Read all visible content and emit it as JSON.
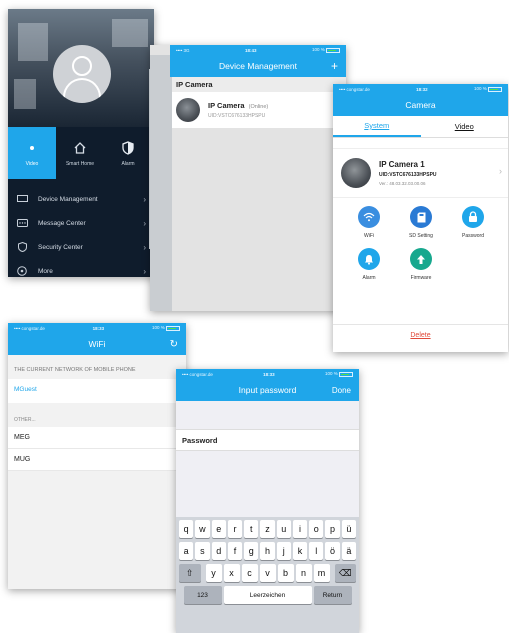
{
  "colors": {
    "accent": "#1fa6ea",
    "menu_bg": "#0f1c2c",
    "danger": "#e04a3a"
  },
  "menu_screen": {
    "tabs": [
      {
        "label": "Video",
        "icon": "dot-icon",
        "active": true
      },
      {
        "label": "Smart Home",
        "icon": "home-icon",
        "active": false
      },
      {
        "label": "Alarm",
        "icon": "shield-icon",
        "active": false
      }
    ],
    "items": [
      {
        "label": "Device Management",
        "icon": "monitor-icon"
      },
      {
        "label": "Message Center",
        "icon": "message-icon"
      },
      {
        "label": "Security Center",
        "icon": "security-shield-icon"
      },
      {
        "label": "More",
        "icon": "more-icon"
      }
    ]
  },
  "device_screen": {
    "status": {
      "left": "•••• 3G",
      "time": "18:43",
      "right": "100 %"
    },
    "title": "Device Management",
    "add": "+",
    "section": "IP Camera",
    "device": {
      "name": "IP Camera",
      "state": "(Online)",
      "uid": "UID:VSTC676133HPSPU"
    }
  },
  "camera_screen": {
    "status": {
      "left": "•••• congstar.de",
      "time": "18:32",
      "right": "100 %"
    },
    "title": "Camera",
    "tabs": [
      "System",
      "Video"
    ],
    "device": {
      "name": "IP Camera 1",
      "uid": "UID:VSTC676133HPSPU",
      "version": "Ver.: 48.03.32.03.00.06"
    },
    "actions": [
      {
        "label": "WiFi",
        "icon": "wifi-icon",
        "color": "#3a8ee0"
      },
      {
        "label": "SD Setting",
        "icon": "sd-card-icon",
        "color": "#2a7ad4"
      },
      {
        "label": "Password",
        "icon": "lock-icon",
        "color": "#1fa6ea"
      },
      {
        "label": "Alarm",
        "icon": "bell-icon",
        "color": "#1fa6ea"
      },
      {
        "label": "Firmware",
        "icon": "upload-icon",
        "color": "#17a88e"
      }
    ],
    "delete": "Delete"
  },
  "wifi_screen": {
    "status": {
      "left": "•••• congstar.de",
      "time": "18:33",
      "right": "100 %"
    },
    "title": "WiFi",
    "refresh": "↻",
    "current_caption": "THE CURRENT NETWORK OF MOBILE PHONE",
    "current": "MGuest",
    "other_caption": "OTHER...",
    "networks": [
      "MEG",
      "MUG"
    ]
  },
  "password_screen": {
    "status": {
      "left": "•••• congstar.de",
      "time": "18:33",
      "right": "100 %"
    },
    "title": "Input password",
    "done": "Done",
    "field_label": "Password",
    "keyboard": {
      "row1": [
        "q",
        "w",
        "e",
        "r",
        "t",
        "z",
        "u",
        "i",
        "o",
        "p",
        "ü"
      ],
      "row2": [
        "a",
        "s",
        "d",
        "f",
        "g",
        "h",
        "j",
        "k",
        "l",
        "ö",
        "ä"
      ],
      "row3": [
        "y",
        "x",
        "c",
        "v",
        "b",
        "n",
        "m"
      ],
      "shift": "⇧",
      "backspace": "⌫",
      "numbers": "123",
      "space": "Leerzeichen",
      "return": "Return"
    }
  }
}
